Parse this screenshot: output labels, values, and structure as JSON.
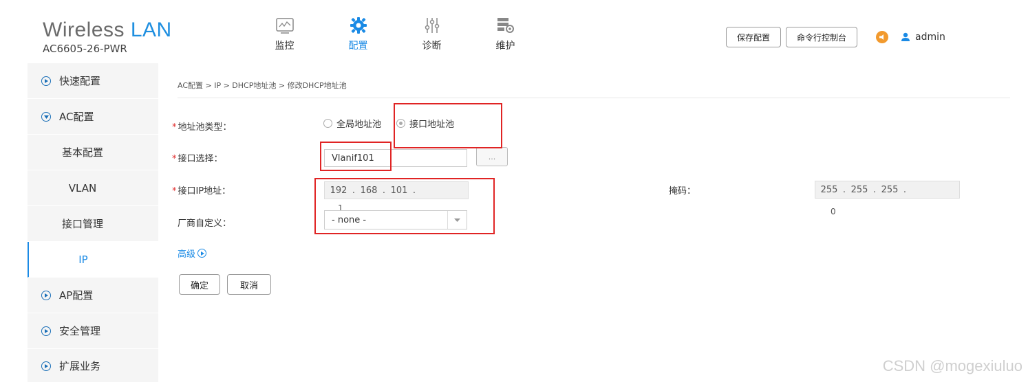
{
  "brand": {
    "title_main": "Wireless ",
    "title_accent": "LAN",
    "model": "AC6605-26-PWR"
  },
  "nav": [
    {
      "label": "监控",
      "icon": "monitor-icon"
    },
    {
      "label": "配置",
      "icon": "gear-icon"
    },
    {
      "label": "诊断",
      "icon": "sliders-icon"
    },
    {
      "label": "维护",
      "icon": "maintenance-icon"
    }
  ],
  "header": {
    "save_label": "保存配置",
    "cli_label": "命令行控制台",
    "user": "admin"
  },
  "sidebar": {
    "items": [
      {
        "label": "快速配置"
      },
      {
        "label": "AC配置"
      },
      {
        "label": "基本配置"
      },
      {
        "label": "VLAN"
      },
      {
        "label": "接口管理"
      },
      {
        "label": "IP"
      },
      {
        "label": "AP配置"
      },
      {
        "label": "安全管理"
      },
      {
        "label": "扩展业务"
      }
    ]
  },
  "breadcrumb": "AC配置 > IP > DHCP地址池 > 修改DHCP地址池",
  "form": {
    "required_mark": "*",
    "pool_type_label": "地址池类型：",
    "pool_type_options": [
      "全局地址池",
      "接口地址池"
    ],
    "pool_type_selected": "接口地址池",
    "interface_label": "接口选择：",
    "interface_value": "Vlanif101",
    "browse_label": "...",
    "ip_label": "接口IP地址：",
    "ip": {
      "o1": "192",
      "o2": "168",
      "o3": "101",
      "o4": "1"
    },
    "mask_label": "掩码：",
    "mask": {
      "o1": "255",
      "o2": "255",
      "o3": "255",
      "o4": "0"
    },
    "vendor_label": "厂商自定义：",
    "vendor_value": "- none -",
    "advanced_label": "高级",
    "ok_label": "确定",
    "cancel_label": "取消"
  },
  "watermark": "CSDN @mogexiuluo",
  "colors": {
    "accent": "#1a8ae5",
    "highlight_box": "#e02424",
    "required": "#e02b2b"
  }
}
